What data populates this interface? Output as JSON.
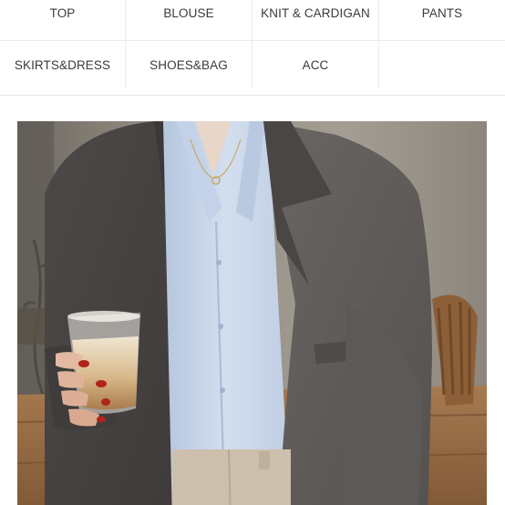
{
  "categories": {
    "row1": [
      "TOP",
      "BLOUSE",
      "KNIT & CARDIGAN",
      "PANTS"
    ],
    "row2": [
      "SKIRTS&DRESS",
      "SHOES&BAG",
      "ACC",
      ""
    ]
  },
  "photo": {
    "subject": "fashion-photo",
    "colors": {
      "background_wall": "#8f8a80",
      "jacket": "#5a5654",
      "shirt": "#c8d6ea",
      "pants": "#cdbfae",
      "table_wood": "#9a6d44",
      "nails": "#b0241c"
    }
  }
}
